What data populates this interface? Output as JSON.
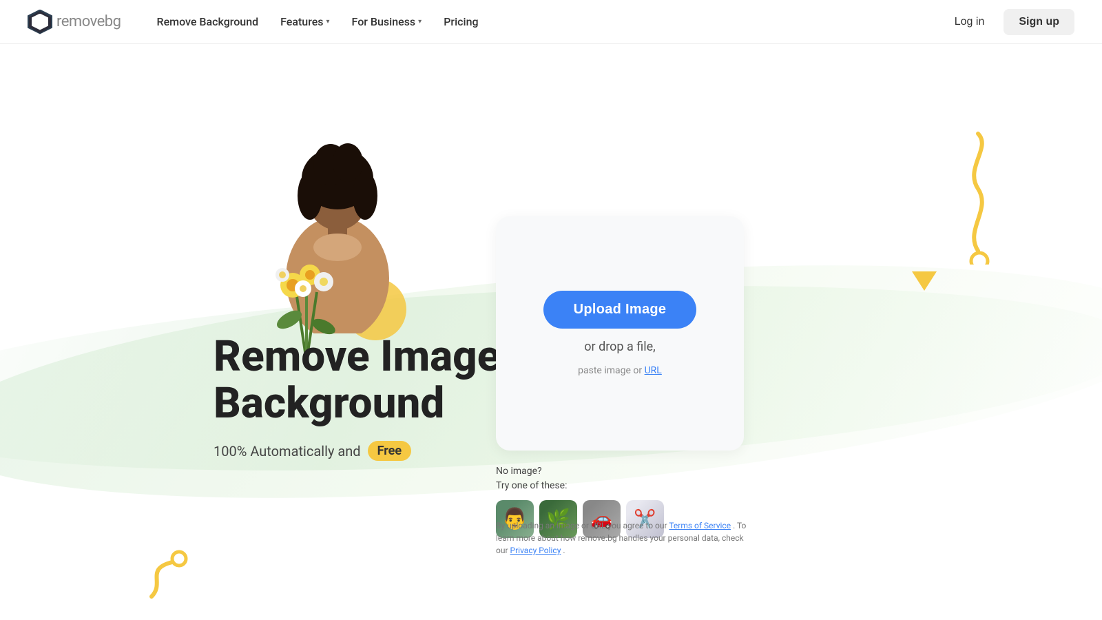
{
  "nav": {
    "logo_remove": "remove",
    "logo_bg": "bg",
    "links": [
      {
        "label": "Remove Background",
        "has_arrow": false
      },
      {
        "label": "Features",
        "has_arrow": true
      },
      {
        "label": "For Business",
        "has_arrow": true
      },
      {
        "label": "Pricing",
        "has_arrow": false
      }
    ],
    "login_label": "Log in",
    "signup_label": "Sign up"
  },
  "hero": {
    "title_line1": "Remove Image",
    "title_line2": "Background",
    "subtitle_text": "100% Automatically and",
    "free_badge": "Free",
    "upload_button": "Upload Image",
    "drop_text": "or drop a file,",
    "paste_text": "paste image or",
    "paste_url": "URL",
    "sample_label_line1": "No image?",
    "sample_label_line2": "Try one of these:",
    "legal_prefix": "By uploading an image or URL you agree to our",
    "legal_tos": "Terms of Service",
    "legal_middle": ". To learn more about how remove.bg handles your personal data, check our",
    "legal_pp": "Privacy Policy",
    "legal_suffix": "."
  }
}
